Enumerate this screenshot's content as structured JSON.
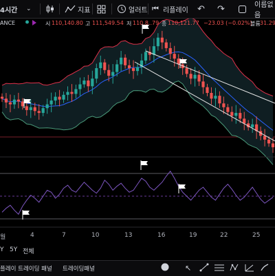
{
  "toolbar": {
    "interval": "4시간",
    "indicators_label": "지표",
    "alert_label": "얼러트",
    "replay_label": "리플레이",
    "unnamed_label": "이름없음"
  },
  "symbol_info": {
    "exchange": "ANCE",
    "open_label": "시",
    "open": "110,140.80",
    "high_label": "고",
    "high": "111,549.54",
    "low_label": "저",
    "low": "110,8..79",
    "close_label": "종",
    "close": "110,121.77",
    "change": "−23.03 (−0.02%)",
    "volume_label": "볼륨",
    "volume": "31.29"
  },
  "time_axis": {
    "labels": [
      "월",
      "4",
      "7",
      "10",
      "13",
      "16",
      "19",
      "22",
      "25"
    ]
  },
  "ranges": [
    "Y",
    "5Y",
    "전체"
  ],
  "bottom_tabs": [
    "플레이 트레이딩 패널",
    "트레이딩패널"
  ],
  "colors": {
    "background": "#000000",
    "up": "#26a69a",
    "down": "#ef5350",
    "band": "#e0314a",
    "basis": "#2962ff",
    "oscillator": "#7e57c2",
    "channel": "#e8e8e8"
  },
  "chart_data": {
    "type": "candlestick",
    "series": [
      {
        "name": "price",
        "close": [
          107400,
          107000,
          106800,
          107300,
          107100,
          106600,
          106200,
          106500,
          106100,
          105900,
          106400,
          106800,
          107200,
          107600,
          107300,
          107800,
          108100,
          107900,
          108400,
          108900,
          109300,
          108700,
          109500,
          110600,
          111200,
          110400,
          109800,
          110200,
          111000,
          111700,
          110900,
          110600,
          110300,
          110700,
          111400,
          112300,
          112000,
          112900,
          113800,
          113300,
          112700,
          112100,
          111600,
          111000,
          110600,
          110000,
          109500,
          109900,
          109200,
          108600,
          108000,
          107400,
          107700,
          106900,
          106500,
          106000,
          105600,
          105900,
          105300,
          104800,
          104400,
          104700,
          104000,
          103500,
          103100,
          102700,
          102300
        ]
      },
      {
        "name": "oscillator",
        "values": [
          38,
          42,
          45,
          40,
          36,
          44,
          50,
          55,
          52,
          48,
          54,
          60,
          58,
          52,
          56,
          62,
          65,
          60,
          58,
          63,
          68,
          64,
          60,
          57,
          62,
          70,
          66,
          60,
          64,
          67,
          62,
          58,
          60,
          66,
          72,
          69,
          63,
          60,
          64,
          68,
          74,
          79,
          72,
          64,
          58,
          54,
          50,
          55,
          60,
          63,
          58,
          53,
          50,
          56,
          62,
          66,
          61,
          55,
          50,
          53,
          58,
          63,
          57,
          51,
          47,
          50,
          53
        ]
      }
    ],
    "annotations": [
      "flag",
      "flag",
      "flag",
      "flag"
    ]
  }
}
